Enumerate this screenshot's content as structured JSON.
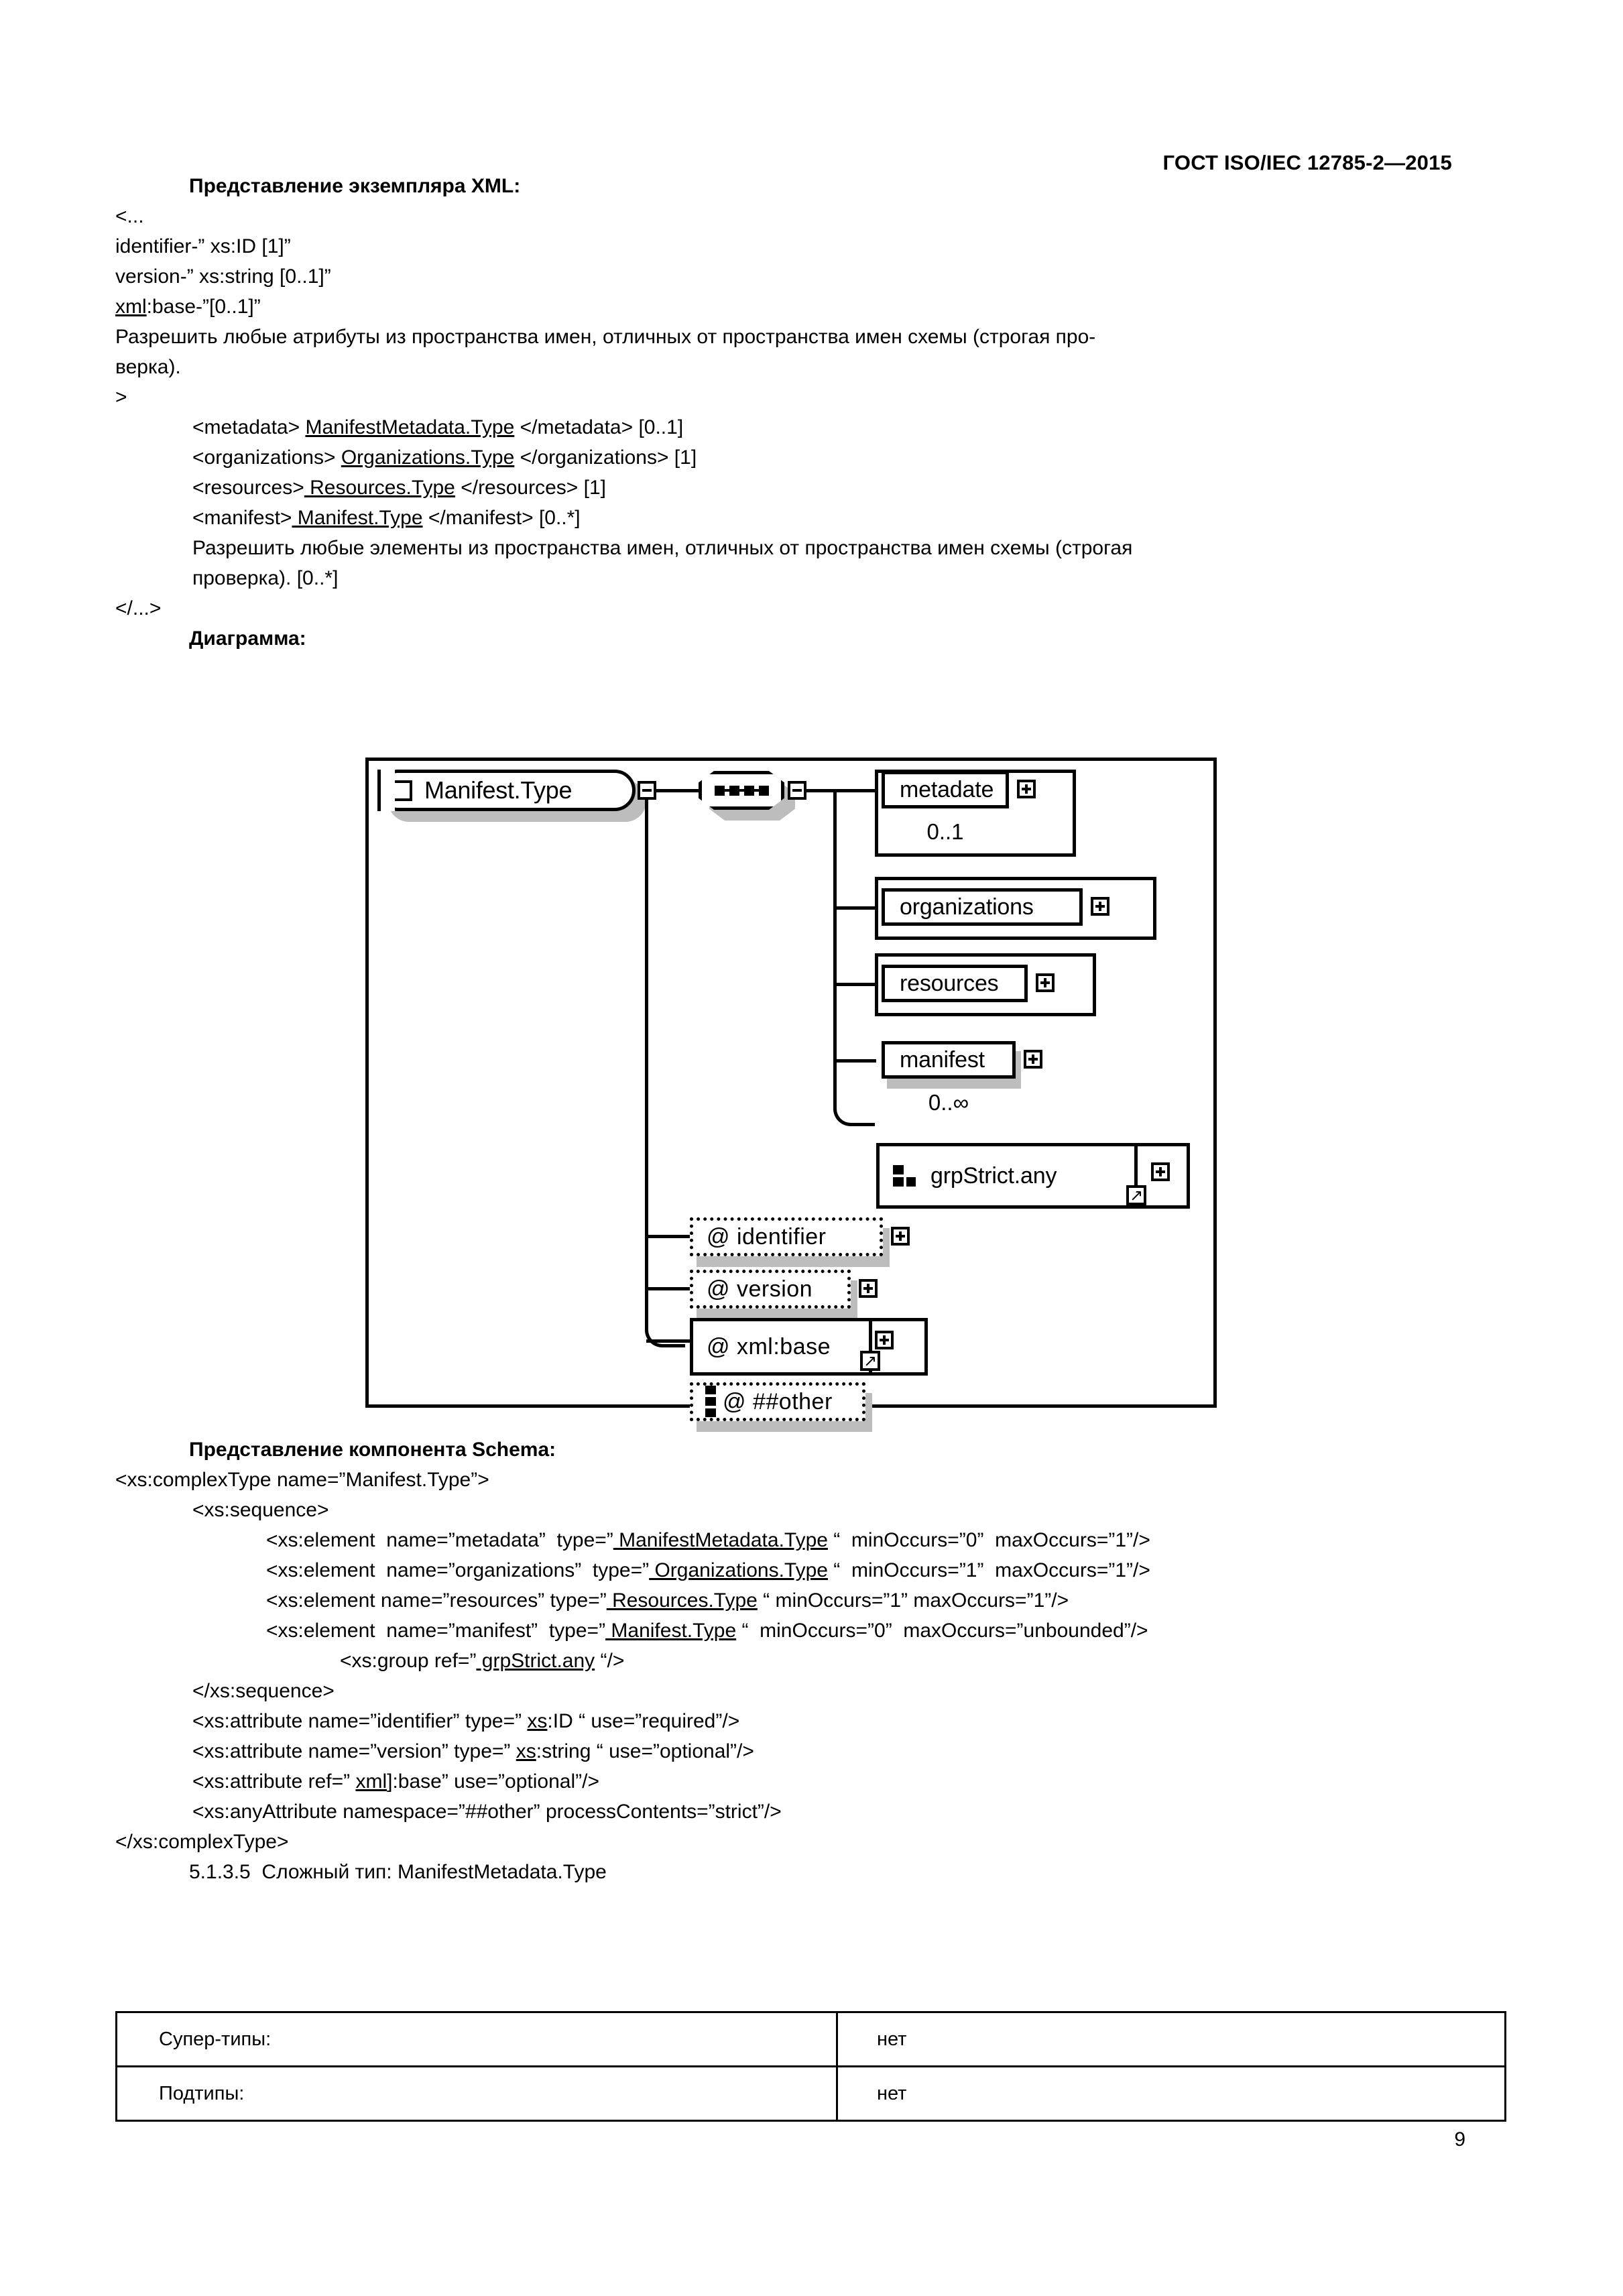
{
  "header": {
    "standard_title": "ГОСТ ISO/IEC 12785-2—2015"
  },
  "sections": {
    "xml_instance_heading": "Представление экземпляра XML:",
    "diagram_heading": "Диаграмма:",
    "schema_component_heading": "Представление компонента Schema:"
  },
  "xml_instance": {
    "lines": [
      "<...",
      "identifier-” xs:ID [1]”",
      "version-” xs:string [0..1]”",
      "xml:base-”[0..1]”",
      "Разрешить любые атрибуты из пространства имен, отличных от пространства имен схемы (строгая про-",
      "верка).",
      ">"
    ],
    "elements": [
      "<metadata> ManifestMetadata.Type </metadata> [0..1]",
      "<organizations> Organizations.Type </organizations> [1]",
      "<resources> Resources.Type </resources> [1]",
      "<manifest> Manifest.Type </manifest> [0..*]"
    ],
    "element_note_1": "Разрешить любые элементы из пространства имен, отличных от пространства имен схемы (строгая",
    "element_note_2": "проверка). [0..*]",
    "closing": "</...>"
  },
  "diagram": {
    "root_type": "Manifest.Type",
    "compositor": "sequence",
    "elements": [
      {
        "name": "metadate",
        "occurs": "0..1"
      },
      {
        "name": "organizations",
        "occurs": ""
      },
      {
        "name": "resources",
        "occurs": ""
      },
      {
        "name": "manifest",
        "occurs": "0..∞"
      }
    ],
    "group_ref": "grpStrict.any",
    "attributes": [
      {
        "name": "@ identifier"
      },
      {
        "name": "@ version"
      },
      {
        "name": "@ xml:base"
      },
      {
        "name": "@ ##other"
      }
    ],
    "toggle_collapse": "−",
    "toggle_expand": "+",
    "ref_arrow": "↗"
  },
  "schema_component": {
    "lines": [
      {
        "indent": 0,
        "text": "<xs:complexType name=”Manifest.Type”>"
      },
      {
        "indent": 1,
        "text": "<xs:sequence>"
      },
      {
        "indent": 2,
        "text": "<xs:element  name=”metadata”  type=” ManifestMetadata.Type “  minOccurs=”0”  maxOccurs=”1”/>"
      },
      {
        "indent": 2,
        "text": "<xs:element  name=”organizations”  type=” Organizations.Type “  minOccurs=”1”  maxOccurs=”1”/>"
      },
      {
        "indent": 2,
        "text": "<xs:element name=”resources” type=” Resources.Type “ minOccurs=”1” maxOccurs=”1”/>"
      },
      {
        "indent": 2,
        "text": "<xs:element  name=”manifest”  type=” Manifest.Type “  minOccurs=”0”  maxOccurs=”unbounded”/>"
      },
      {
        "indent": 2,
        "text": "<xs:group ref=” grpStrict.any “/>"
      },
      {
        "indent": 1,
        "text": "</xs:sequence>"
      },
      {
        "indent": 1,
        "text": "<xs:attribute name=”identifier” type=” xs:ID “ use=”required”/>"
      },
      {
        "indent": 1,
        "text": "<xs:attribute name=”version” type=” xs:string “ use=”optional”/>"
      },
      {
        "indent": 1,
        "text": "<xs:attribute ref=” xml:base” use=”optional”/>"
      },
      {
        "indent": 1,
        "text": "<xs:anyAttribute namespace=”##other” processContents=”strict”/>"
      },
      {
        "indent": 0,
        "text": "</xs:complexType>"
      }
    ],
    "subsection": "5.1.3.5  Сложный тип: ManifestMetadata.Type"
  },
  "table": {
    "rows": [
      {
        "label": "Супер-типы:",
        "value": "нет"
      },
      {
        "label": "Подтипы:",
        "value": "нет"
      }
    ]
  },
  "footer": {
    "page_number": "9"
  }
}
